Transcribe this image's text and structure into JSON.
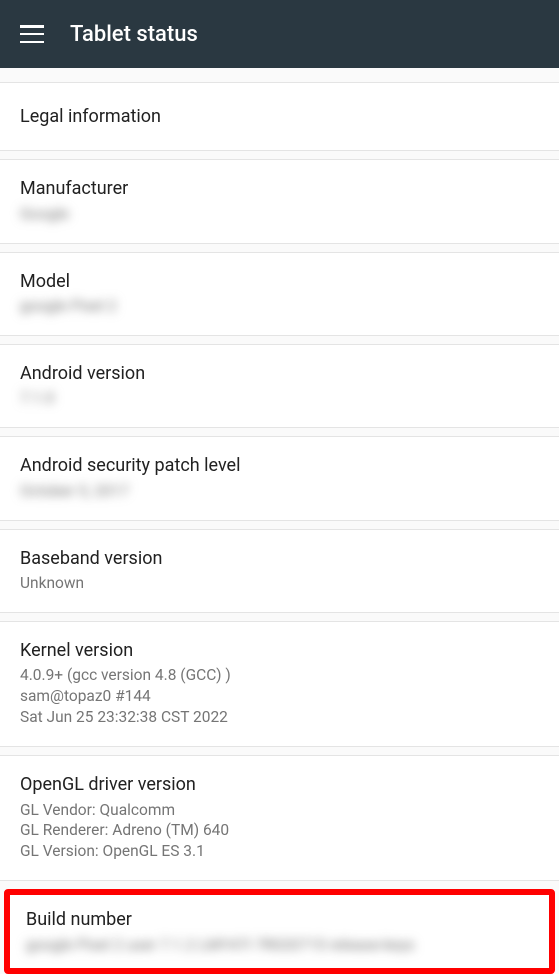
{
  "header": {
    "title": "Tablet status"
  },
  "items": {
    "legal": {
      "title": "Legal information"
    },
    "manufacturer": {
      "title": "Manufacturer",
      "value": "Google"
    },
    "model": {
      "title": "Model",
      "value": "google Pixel 2"
    },
    "android_version": {
      "title": "Android version",
      "value": "7.1.0"
    },
    "security_patch": {
      "title": "Android security patch level",
      "value": "October 5, 2017"
    },
    "baseband": {
      "title": "Baseband version",
      "value": "Unknown"
    },
    "kernel": {
      "title": "Kernel version",
      "value": "4.0.9+ (gcc version 4.8 (GCC) )\nsam@topaz0 #144\nSat Jun 25 23:32:38 CST 2022"
    },
    "opengl": {
      "title": "OpenGL driver version",
      "value": "GL Vendor: Qualcomm\nGL Renderer: Adreno (TM) 640\nGL Version: OpenGL ES 3.1"
    },
    "build": {
      "title": "Build number",
      "value": "google Pixel 2 user 7.1.2 LMY47I 7R020715 release-keys"
    }
  }
}
